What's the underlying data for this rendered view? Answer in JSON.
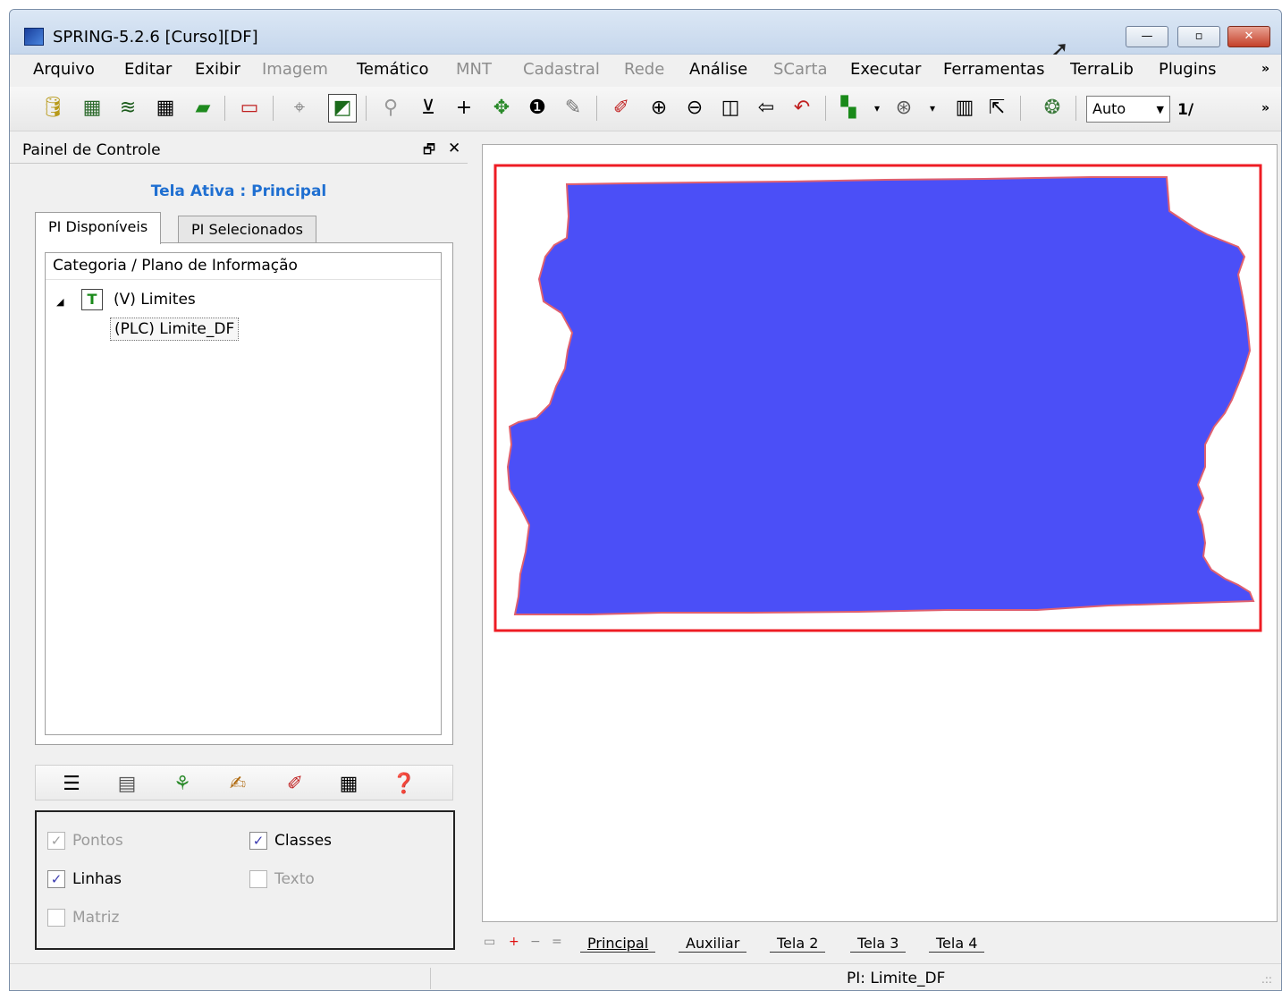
{
  "window": {
    "title": "SPRING-5.2.6 [Curso][DF]",
    "minimize_label": "—",
    "maximize_label": "▫",
    "close_label": "✕"
  },
  "menu": {
    "items": [
      {
        "label": "Arquivo",
        "enabled": true
      },
      {
        "label": "Editar",
        "enabled": true
      },
      {
        "label": "Exibir",
        "enabled": true
      },
      {
        "label": "Imagem",
        "enabled": false
      },
      {
        "label": "Temático",
        "enabled": true
      },
      {
        "label": "MNT",
        "enabled": false
      },
      {
        "label": "Cadastral",
        "enabled": false
      },
      {
        "label": "Rede",
        "enabled": false
      },
      {
        "label": "Análise",
        "enabled": true
      },
      {
        "label": "SCarta",
        "enabled": false
      },
      {
        "label": "Executar",
        "enabled": true
      },
      {
        "label": "Ferramentas",
        "enabled": true
      },
      {
        "label": "TerraLib",
        "enabled": true
      },
      {
        "label": "Plugins",
        "enabled": true
      }
    ],
    "more_label": "»"
  },
  "toolbar": {
    "zoom_value": "Auto",
    "scale_label": "1/",
    "more_label": "»",
    "icons": [
      "database-icon",
      "project-icon",
      "layers-icon",
      "grid-icon",
      "plane-icon",
      "window-icon",
      "select-icon",
      "display-icon",
      "magnifier-icon",
      "fit-icon",
      "plus-icon",
      "pan-icon",
      "info-icon",
      "edit-icon",
      "pencil-icon",
      "zoom-in-icon",
      "zoom-out-icon",
      "zoom-area-icon",
      "previous-icon",
      "undo-icon",
      "color-icon",
      "scale-icon",
      "chart-icon",
      "cursor-plus-icon",
      "palette-icon"
    ]
  },
  "panel": {
    "title": "Painel de Controle",
    "dock_label": "🗗",
    "close_label": "✕",
    "active_screen": "Tela Ativa : Principal",
    "tabs": [
      "PI Disponíveis",
      "PI Selecionados"
    ],
    "tree_header": "Categoria / Plano de Informação",
    "category": {
      "badge": "T",
      "label": "(V) Limites",
      "expand_label": "◢"
    },
    "plan": "(PLC) Limite_DF",
    "visibility": [
      {
        "label": "Pontos",
        "checked": true,
        "enabled": false
      },
      {
        "label": "Classes",
        "checked": true,
        "enabled": true
      },
      {
        "label": "Linhas",
        "checked": true,
        "enabled": true
      },
      {
        "label": "Texto",
        "checked": false,
        "enabled": false
      },
      {
        "label": "Matriz",
        "checked": false,
        "enabled": false
      }
    ]
  },
  "map": {
    "fill_color": "#4b4ff7",
    "outline_color": "#e0606e",
    "frame_color": "#ee1c24"
  },
  "screen_tabs": {
    "controls": [
      "▭",
      "+",
      "−",
      "="
    ],
    "tabs": [
      "Principal",
      "Auxiliar",
      "Tela 2",
      "Tela 3",
      "Tela 4"
    ],
    "active": "Principal"
  },
  "status": {
    "text": "PI: Limite_DF",
    "grip": ".::"
  }
}
